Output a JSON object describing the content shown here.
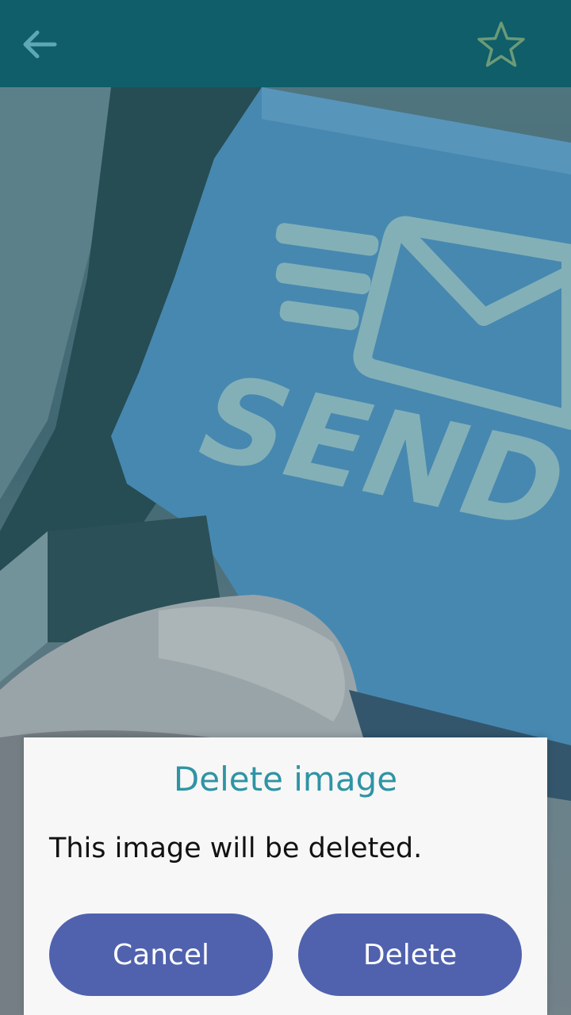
{
  "header": {
    "back_icon": "arrow-left-icon",
    "favorite_icon": "star-outline-icon"
  },
  "photo": {
    "key_label": "SEND",
    "key_icon": "envelope-icon",
    "description_colors": {
      "key": "#5b97c9",
      "overlay_tint": "#0a4650"
    }
  },
  "dialog": {
    "title": "Delete image",
    "message": "This image will be deleted.",
    "cancel_label": "Cancel",
    "delete_label": "Delete"
  },
  "colors": {
    "topbar": "#0f5e69",
    "dialog_title": "#2e94a4",
    "button": "#5062ae",
    "dialog_bg": "#f7f7f7"
  }
}
